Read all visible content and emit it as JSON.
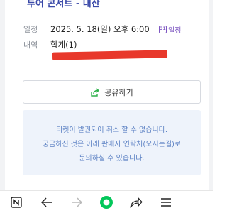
{
  "event": {
    "title": "투어 콘서트 - 내산"
  },
  "details": {
    "date_label": "일정",
    "date_value": "2025. 5. 18(일) 오후 6:00",
    "calendar_icon": "calendar-31-icon",
    "calendar_icon_text": "31",
    "calendar_label": "일정",
    "content_label": "내역",
    "content_value": "합계(1)"
  },
  "share": {
    "label": "공유하기",
    "icon": "share-icon"
  },
  "notice": {
    "lines": [
      "티켓이 발권되어 취소 할 수 없습니다.",
      "궁금하신 것은 아래 판매자 연락처(오시는길)로",
      "문의하실 수 있습니다."
    ]
  },
  "browser_nav": {
    "icons": [
      "naver-icon",
      "back-arrow-icon",
      "forward-arrow-icon",
      "home-icon",
      "share-arrow-icon",
      "menu-icon"
    ]
  },
  "colors": {
    "accent": "#3a49a8",
    "calendar": "#7e57c2",
    "notice_text": "#5d82c4",
    "notice_bg": "#eef3fb",
    "home_green": "#03c75a",
    "redaction": "#e8382b"
  }
}
